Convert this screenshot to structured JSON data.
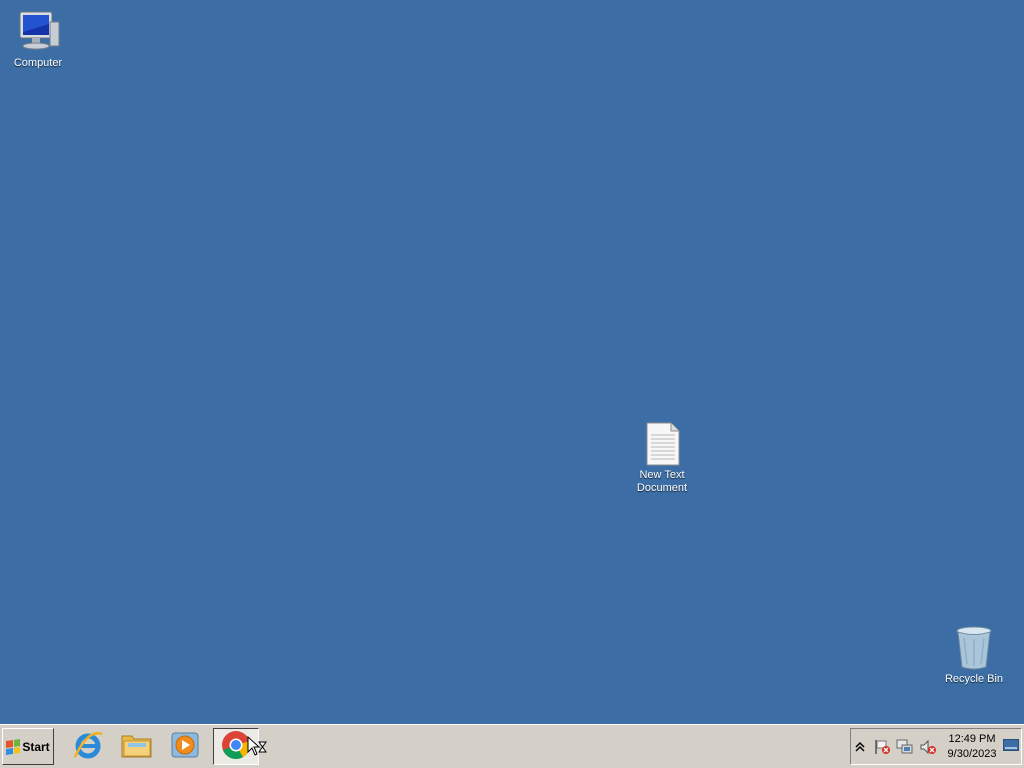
{
  "desktop": {
    "background_color": "#3c6ea5",
    "icons": [
      {
        "label": "Computer",
        "icon": "computer-icon"
      },
      {
        "label": "New Text\nDocument",
        "icon": "text-document-icon"
      },
      {
        "label": "Recycle Bin",
        "icon": "recycle-bin-icon"
      }
    ]
  },
  "taskbar": {
    "start_label": "Start",
    "apps": [
      {
        "name": "Internet Explorer",
        "icon": "internet-explorer-icon"
      },
      {
        "name": "File Explorer",
        "icon": "folder-icon"
      },
      {
        "name": "Windows Media Player",
        "icon": "media-player-icon"
      },
      {
        "name": "Google Chrome",
        "icon": "chrome-icon",
        "active": true
      }
    ],
    "tray": {
      "icons": [
        "show-hidden-icons-chevron",
        "action-center-flag-icon",
        "network-icon",
        "volume-muted-icon"
      ],
      "time": "12:49 PM",
      "date": "9/30/2023"
    }
  }
}
